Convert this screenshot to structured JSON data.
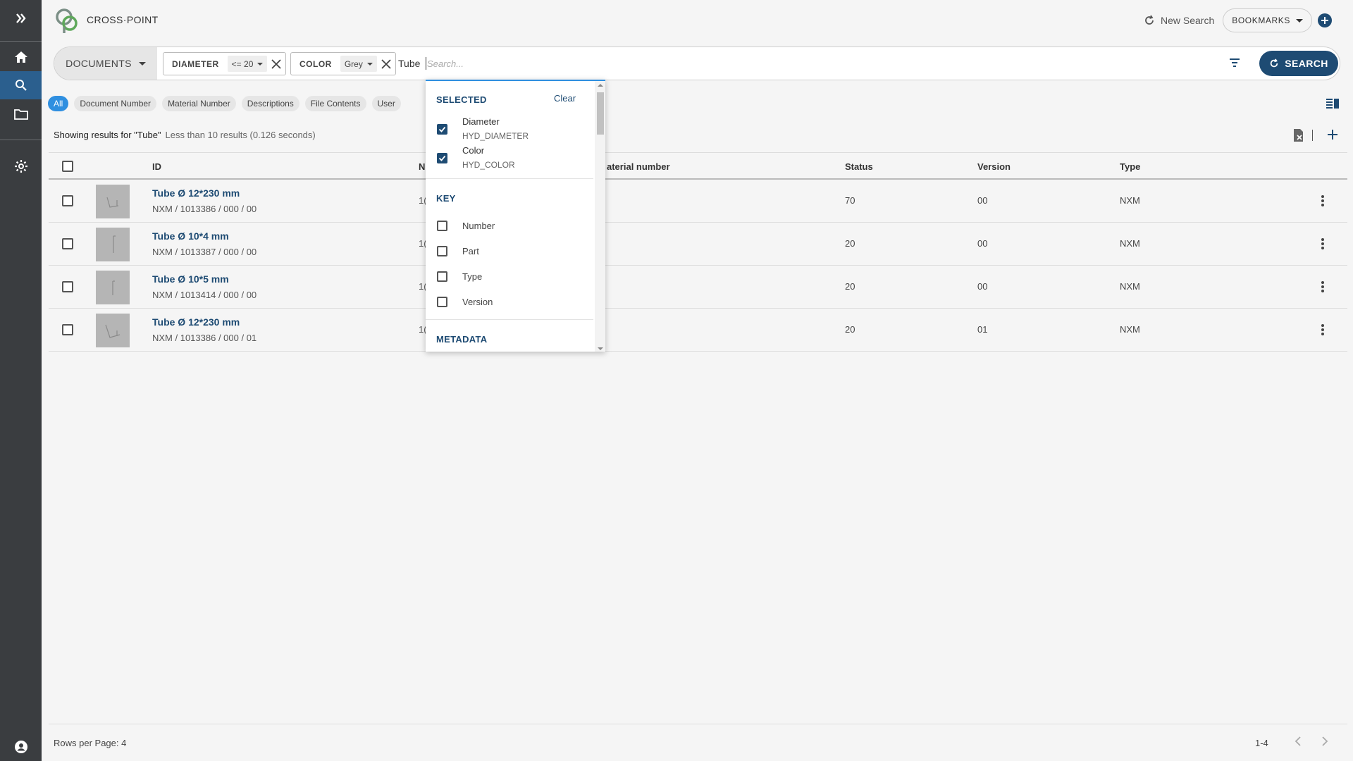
{
  "app": {
    "brand": "CROSS·POINT"
  },
  "header": {
    "new_search_label": "New Search",
    "bookmarks_label": "BOOKMARKS"
  },
  "search": {
    "scope_label": "DOCUMENTS",
    "filters": [
      {
        "key": "DIAMETER",
        "value": "<= 20"
      },
      {
        "key": "COLOR",
        "value": "Grey"
      }
    ],
    "query": "Tube",
    "placeholder": "Search...",
    "button_label": "SEARCH"
  },
  "tabs": [
    "All",
    "Document Number",
    "Material Number",
    "Descriptions",
    "File Contents",
    "User"
  ],
  "results_status": {
    "query_text": "Showing results for \"Tube\"",
    "count_text": "Less than 10 results (0.126 seconds)"
  },
  "table": {
    "columns": {
      "id": "ID",
      "number_truncated": "N",
      "material_number": "aterial number",
      "status": "Status",
      "version": "Version",
      "type": "Type"
    },
    "rows": [
      {
        "title": "Tube Ø 12*230 mm",
        "subtitle": "NXM / 1013386 / 000 / 00",
        "trunc": "1(",
        "status": "70",
        "version": "00",
        "type": "NXM"
      },
      {
        "title": "Tube Ø 10*4 mm",
        "subtitle": "NXM / 1013387 / 000 / 00",
        "trunc": "1(",
        "status": "20",
        "version": "00",
        "type": "NXM"
      },
      {
        "title": "Tube Ø 10*5 mm",
        "subtitle": "NXM / 1013414 / 000 / 00",
        "trunc": "1(",
        "status": "20",
        "version": "00",
        "type": "NXM"
      },
      {
        "title": "Tube Ø 12*230 mm",
        "subtitle": "NXM / 1013386 / 000 / 01",
        "trunc": "1(",
        "status": "20",
        "version": "01",
        "type": "NXM"
      }
    ]
  },
  "dropdown": {
    "selected_header": "SELECTED",
    "clear_label": "Clear",
    "selected": [
      {
        "label": "Diameter",
        "code": "HYD_DIAMETER",
        "checked": true
      },
      {
        "label": "Color",
        "code": "HYD_COLOR",
        "checked": true
      }
    ],
    "key_header": "KEY",
    "key_items": [
      "Number",
      "Part",
      "Type",
      "Version"
    ],
    "metadata_header": "METADATA"
  },
  "footer": {
    "rows_per_page": "Rows per Page: 4",
    "range": "1-4"
  },
  "colors": {
    "rail": "#3a3d40",
    "rail_active": "#2b5f8e",
    "primary": "#1e4b73",
    "tab_selected": "#2f8fe0"
  },
  "icons": [
    "expand-icon",
    "home-icon",
    "search-icon",
    "folder-icon",
    "settings-icon",
    "account-icon",
    "refresh-icon",
    "add-icon",
    "filter-icon",
    "close-icon",
    "view-toggle-icon",
    "export-icon",
    "more-vert-icon",
    "chevron-left-icon",
    "chevron-right-icon"
  ]
}
